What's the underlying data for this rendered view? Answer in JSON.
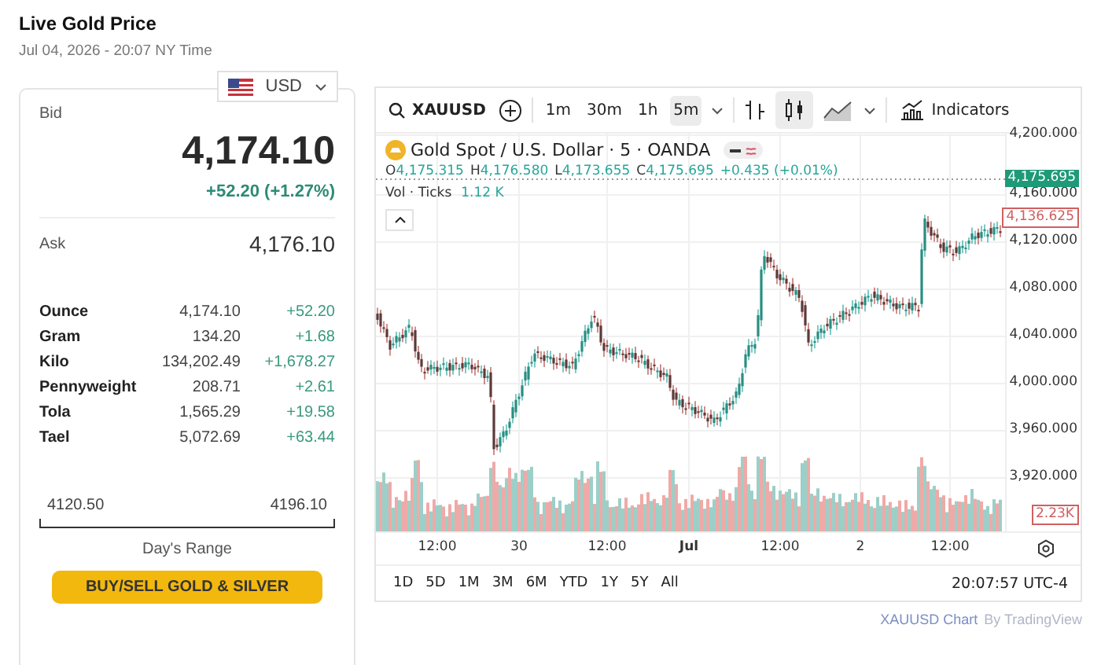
{
  "header": {
    "title": "Live Gold Price",
    "subtitle": "Jul 04, 2026 - 20:07 NY Time"
  },
  "currency": {
    "label": "USD"
  },
  "bid": {
    "label": "Bid",
    "price": "4,174.10",
    "change": "+52.20 (+1.27%)"
  },
  "ask": {
    "label": "Ask",
    "price": "4,176.10"
  },
  "units": [
    {
      "name": "Ounce",
      "price": "4,174.10",
      "change": "+52.20"
    },
    {
      "name": "Gram",
      "price": "134.20",
      "change": "+1.68"
    },
    {
      "name": "Kilo",
      "price": "134,202.49",
      "change": "+1,678.27"
    },
    {
      "name": "Pennyweight",
      "price": "208.71",
      "change": "+2.61"
    },
    {
      "name": "Tola",
      "price": "1,565.29",
      "change": "+19.58"
    },
    {
      "name": "Tael",
      "price": "5,072.69",
      "change": "+63.44"
    }
  ],
  "day_range": {
    "low": "4120.50",
    "high": "4196.10",
    "label": "Day's Range"
  },
  "buy_button": "BUY/SELL GOLD & SILVER",
  "chart": {
    "symbol": "XAUUSD",
    "intervals": [
      {
        "label": "1m",
        "selected": false
      },
      {
        "label": "30m",
        "selected": false
      },
      {
        "label": "1h",
        "selected": false
      },
      {
        "label": "5m",
        "selected": true
      }
    ],
    "indicators": "Indicators",
    "legend_title": "Gold Spot / U.S. Dollar · 5 · OANDA",
    "ohlc": [
      {
        "key": "O",
        "value": "4,175.315"
      },
      {
        "key": "H",
        "value": "4,176.580"
      },
      {
        "key": "L",
        "value": "4,173.655"
      },
      {
        "key": "C",
        "value": "4,175.695"
      }
    ],
    "ohlc_change": "+0.435 (+0.01%)",
    "vol_label": "Vol · Ticks",
    "vol_value": "1.12 K",
    "price_ticks": [
      "4,200.000",
      "4,160.000",
      "4,120.000",
      "4,080.000",
      "4,040.000",
      "4,000.000",
      "3,960.000",
      "3,920.000"
    ],
    "last_price": "4,175.695",
    "marker_price": "4,136.625",
    "vol_marker": "2.23K",
    "time_ticks": [
      {
        "label": "12:00",
        "bold": false
      },
      {
        "label": "30",
        "bold": false
      },
      {
        "label": "12:00",
        "bold": false
      },
      {
        "label": "Jul",
        "bold": true
      },
      {
        "label": "12:00",
        "bold": false
      },
      {
        "label": "2",
        "bold": false
      },
      {
        "label": "12:00",
        "bold": false
      }
    ],
    "ranges": [
      "1D",
      "5D",
      "1M",
      "3M",
      "6M",
      "YTD",
      "1Y",
      "5Y",
      "All"
    ],
    "clock": "20:07:57 UTC-4"
  },
  "footer": {
    "link": "XAUUSD Chart",
    "by": "By TradingView"
  }
}
